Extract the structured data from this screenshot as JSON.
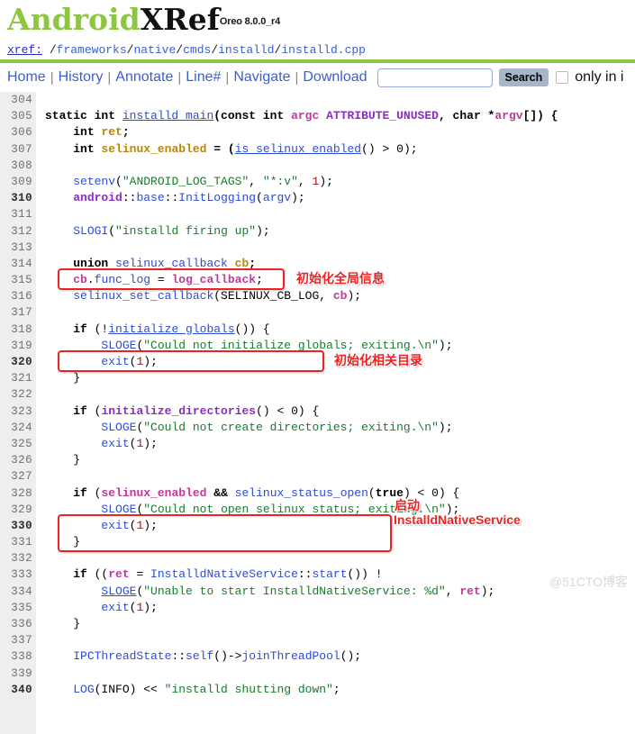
{
  "header": {
    "logo_android": "Android",
    "logo_xref": "XRef",
    "version": "Oreo 8.0.0_r4"
  },
  "path": {
    "label": "xref:",
    "separator": "/",
    "segments": [
      "frameworks",
      "native",
      "cmds",
      "installd",
      "installd.cpp"
    ]
  },
  "nav": {
    "items": [
      {
        "label": "Home"
      },
      {
        "label": "History"
      },
      {
        "label": "Annotate"
      },
      {
        "label": "Line#"
      },
      {
        "label": "Navigate"
      },
      {
        "label": "Download"
      }
    ],
    "divider": "|",
    "search_value": "",
    "search_placeholder": "",
    "search_button": "Search",
    "only_in_label": "only in i"
  },
  "code": {
    "lines": [
      {
        "n": "304",
        "bold": false
      },
      {
        "n": "305",
        "bold": false
      },
      {
        "n": "306",
        "bold": false
      },
      {
        "n": "307",
        "bold": false
      },
      {
        "n": "308",
        "bold": false
      },
      {
        "n": "309",
        "bold": false
      },
      {
        "n": "310",
        "bold": true
      },
      {
        "n": "311",
        "bold": false
      },
      {
        "n": "312",
        "bold": false
      },
      {
        "n": "313",
        "bold": false
      },
      {
        "n": "314",
        "bold": false
      },
      {
        "n": "315",
        "bold": false
      },
      {
        "n": "316",
        "bold": false
      },
      {
        "n": "317",
        "bold": false
      },
      {
        "n": "318",
        "bold": false
      },
      {
        "n": "319",
        "bold": false
      },
      {
        "n": "320",
        "bold": true
      },
      {
        "n": "321",
        "bold": false
      },
      {
        "n": "322",
        "bold": false
      },
      {
        "n": "323",
        "bold": false
      },
      {
        "n": "324",
        "bold": false
      },
      {
        "n": "325",
        "bold": false
      },
      {
        "n": "326",
        "bold": false
      },
      {
        "n": "327",
        "bold": false
      },
      {
        "n": "328",
        "bold": false
      },
      {
        "n": "329",
        "bold": false
      },
      {
        "n": "330",
        "bold": true
      },
      {
        "n": "331",
        "bold": false
      },
      {
        "n": "332",
        "bold": false
      },
      {
        "n": "333",
        "bold": false
      },
      {
        "n": "334",
        "bold": false
      },
      {
        "n": "335",
        "bold": false
      },
      {
        "n": "336",
        "bold": false
      },
      {
        "n": "337",
        "bold": false
      },
      {
        "n": "338",
        "bold": false
      },
      {
        "n": "339",
        "bold": false
      },
      {
        "n": "340",
        "bold": true
      }
    ],
    "text": {
      "l304": "",
      "l305": "static int installd_main(const int argc ATTRIBUTE_UNUSED, char *argv[]) {",
      "l306": "    int ret;",
      "l307": "    int selinux_enabled = (is_selinux_enabled() > 0);",
      "l308": "",
      "l309": "    setenv(\"ANDROID_LOG_TAGS\", \"*:v\", 1);",
      "l310": "    android::base::InitLogging(argv);",
      "l311": "",
      "l312": "    SLOGI(\"installd firing up\");",
      "l313": "",
      "l314": "    union selinux_callback cb;",
      "l315": "    cb.func_log = log_callback;",
      "l316": "    selinux_set_callback(SELINUX_CB_LOG, cb);",
      "l317": "",
      "l318": "    if (!initialize_globals()) {",
      "l319": "        SLOGE(\"Could not initialize globals; exiting.\\n\");",
      "l320": "        exit(1);",
      "l321": "    }",
      "l322": "",
      "l323": "    if (initialize_directories() < 0) {",
      "l324": "        SLOGE(\"Could not create directories; exiting.\\n\");",
      "l325": "        exit(1);",
      "l326": "    }",
      "l327": "",
      "l328": "    if (selinux_enabled && selinux_status_open(true) < 0) {",
      "l329": "        SLOGE(\"Could not open selinux status; exiting.\\n\");",
      "l330": "        exit(1);",
      "l331": "    }",
      "l332": "",
      "l333": "    if ((ret = InstalldNativeService::start()) != ",
      "l334": "        SLOGE(\"Unable to start InstalldNativeService: %d\", ret);",
      "l335": "        exit(1);",
      "l336": "    }",
      "l337": "",
      "l338": "    IPCThreadState::self()->joinThreadPool();",
      "l339": "",
      "l340": "    LOG(INFO) << \"installd shutting down\";"
    }
  },
  "annotations": [
    {
      "text": "初始化全局信息"
    },
    {
      "text": "初始化相关目录"
    },
    {
      "text": "启动"
    },
    {
      "text": "InstalldNativeService"
    }
  ],
  "watermark": "@51CTO博客",
  "colors": {
    "brand_green": "#8DC63F",
    "link_blue": "#3b5fd0",
    "annotation_red": "#ee2222",
    "gutter_bg": "#eeeeee"
  }
}
